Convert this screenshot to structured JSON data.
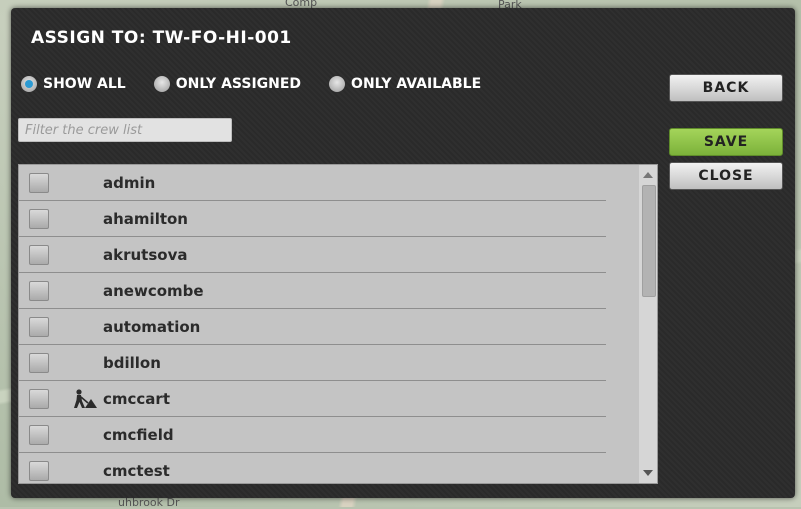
{
  "dialog": {
    "title": "ASSIGN TO: TW-FO-HI-001"
  },
  "filters": {
    "show_all": "SHOW ALL",
    "only_assigned": "ONLY ASSIGNED",
    "only_available": "ONLY AVAILABLE",
    "selected": "show_all"
  },
  "search": {
    "placeholder": "Filter the crew list",
    "value": ""
  },
  "crew": [
    {
      "name": "admin",
      "has_icon": false
    },
    {
      "name": "ahamilton",
      "has_icon": false
    },
    {
      "name": "akrutsova",
      "has_icon": false
    },
    {
      "name": "anewcombe",
      "has_icon": false
    },
    {
      "name": "automation",
      "has_icon": false
    },
    {
      "name": "bdillon",
      "has_icon": false
    },
    {
      "name": "cmccart",
      "has_icon": true,
      "icon": "worker-icon"
    },
    {
      "name": "cmcfield",
      "has_icon": false
    },
    {
      "name": "cmctest",
      "has_icon": false
    }
  ],
  "buttons": {
    "back": "BACK",
    "save": "SAVE",
    "close": "CLOSE"
  },
  "map_labels": {
    "top": "Comp",
    "top_right": "Park",
    "bottom": "uhbrook Dr"
  },
  "colors": {
    "dialog_bg": "#2b2b2b",
    "radio_selected": "#2b9ad3",
    "save_button": "#8cc145"
  }
}
